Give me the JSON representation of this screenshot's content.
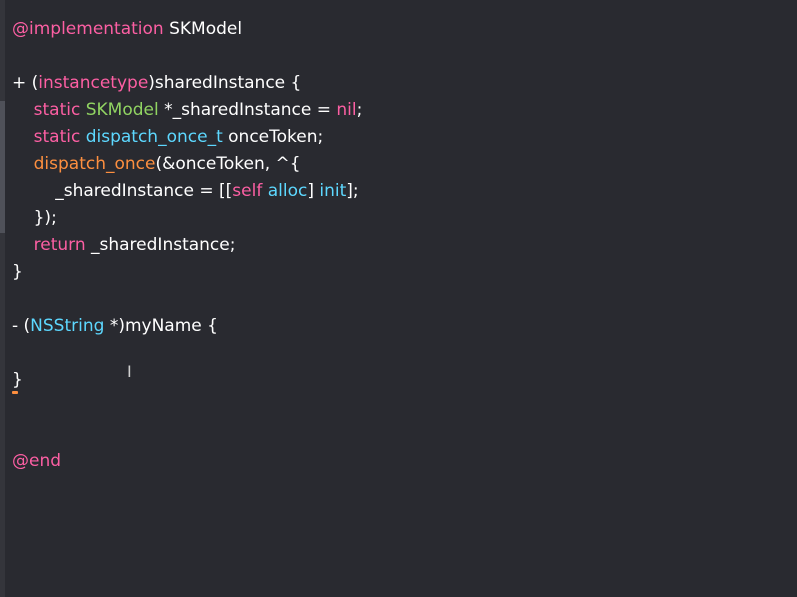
{
  "editor": {
    "lines": [
      {
        "id": "l1",
        "tokens": [
          {
            "t": "@implementation",
            "c": "kw"
          },
          {
            "t": " SKModel",
            "c": "pl"
          }
        ]
      },
      {
        "id": "l2",
        "tokens": []
      },
      {
        "id": "l3",
        "tokens": [
          {
            "t": "+ (",
            "c": "pl"
          },
          {
            "t": "instancetype",
            "c": "kw"
          },
          {
            "t": ")sharedInstance {",
            "c": "pl"
          }
        ]
      },
      {
        "id": "l4",
        "tokens": [
          {
            "t": "    ",
            "c": "pl"
          },
          {
            "t": "static",
            "c": "kw"
          },
          {
            "t": " ",
            "c": "pl"
          },
          {
            "t": "SKModel",
            "c": "green"
          },
          {
            "t": " *_sharedInstance = ",
            "c": "pl"
          },
          {
            "t": "nil",
            "c": "kw"
          },
          {
            "t": ";",
            "c": "pl"
          }
        ]
      },
      {
        "id": "l5",
        "tokens": [
          {
            "t": "    ",
            "c": "pl"
          },
          {
            "t": "static",
            "c": "kw"
          },
          {
            "t": " ",
            "c": "pl"
          },
          {
            "t": "dispatch_once_t",
            "c": "type"
          },
          {
            "t": " onceToken;",
            "c": "pl"
          }
        ]
      },
      {
        "id": "l6",
        "tokens": [
          {
            "t": "    ",
            "c": "pl"
          },
          {
            "t": "dispatch_once",
            "c": "macro"
          },
          {
            "t": "(&onceToken, ^{",
            "c": "pl"
          }
        ]
      },
      {
        "id": "l7",
        "tokens": [
          {
            "t": "        _sharedInstance = [[",
            "c": "pl"
          },
          {
            "t": "self",
            "c": "kw"
          },
          {
            "t": " ",
            "c": "pl"
          },
          {
            "t": "alloc",
            "c": "type"
          },
          {
            "t": "] ",
            "c": "pl"
          },
          {
            "t": "init",
            "c": "type"
          },
          {
            "t": "];",
            "c": "pl"
          }
        ]
      },
      {
        "id": "l8",
        "tokens": [
          {
            "t": "    });",
            "c": "pl"
          }
        ]
      },
      {
        "id": "l9",
        "tokens": [
          {
            "t": "    ",
            "c": "pl"
          },
          {
            "t": "return",
            "c": "kw"
          },
          {
            "t": " _sharedInstance;",
            "c": "pl"
          }
        ]
      },
      {
        "id": "l10",
        "tokens": [
          {
            "t": "}",
            "c": "pl"
          }
        ]
      },
      {
        "id": "l11",
        "tokens": []
      },
      {
        "id": "l12",
        "tokens": [
          {
            "t": "- (",
            "c": "pl"
          },
          {
            "t": "NSString",
            "c": "type"
          },
          {
            "t": " *)myName {",
            "c": "pl"
          }
        ]
      },
      {
        "id": "l13",
        "tokens": []
      },
      {
        "id": "l14",
        "tokens": [
          {
            "t": "}",
            "c": "pl"
          }
        ]
      },
      {
        "id": "l15",
        "tokens": []
      },
      {
        "id": "l16",
        "tokens": []
      },
      {
        "id": "l17",
        "tokens": [
          {
            "t": "@end",
            "c": "kw"
          }
        ]
      }
    ],
    "colors": {
      "background": "#292a30",
      "keyword": "#fc5fa3",
      "type": "#5dd8ff",
      "class_name": "#91d462",
      "macro": "#fd8f3f",
      "plain": "#ffffff"
    },
    "cursor_icon": "ibeam-cursor-icon",
    "ibeam_glyph": "Ι"
  }
}
